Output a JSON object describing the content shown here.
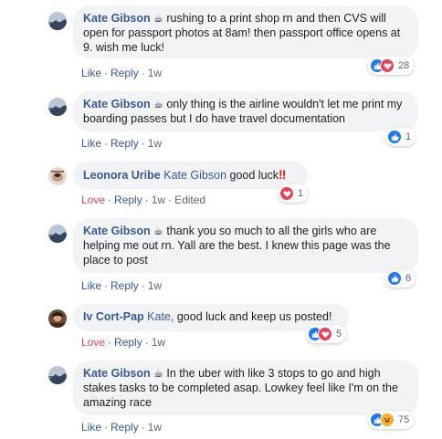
{
  "comments": [
    {
      "author": "Kate Gibson",
      "badge": "☕",
      "text": "rushing to a print shop rn and then CVS will open for passport photos at 8am! then passport office opens at 9. wish me luck!",
      "actions": [
        "Like",
        "Reply"
      ],
      "time": "1w",
      "reactions": [
        "like",
        "love"
      ],
      "count": "28"
    },
    {
      "author": "Kate Gibson",
      "badge": "☕",
      "text": "only thing is the airline wouldn't let me print my boarding passes but I do have travel documentation",
      "actions": [
        "Like",
        "Reply"
      ],
      "time": "1w",
      "reactions": [
        "like"
      ],
      "count": "1"
    },
    {
      "author": "Leonora Uribe",
      "mention": "Kate Gibson",
      "text": "good luck",
      "emphasis": "‼",
      "actions": [
        "Love",
        "Reply"
      ],
      "time": "1w",
      "edited": "Edited",
      "reactions": [
        "love"
      ],
      "count": "1"
    },
    {
      "author": "Kate Gibson",
      "badge": "☕",
      "text": "thank you so much to all the girls who are helping me out rn. Yall are the best. I knew this page was the place to post",
      "actions": [
        "Like",
        "Reply"
      ],
      "time": "1w",
      "reactions": [
        "like"
      ],
      "count": "6"
    },
    {
      "author": "Iv Cort-Pap",
      "mention": "Kate,",
      "text": "good luck and keep us posted!",
      "actions": [
        "Love",
        "Reply"
      ],
      "time": "1w",
      "reactions": [
        "like",
        "love"
      ],
      "count": "5"
    },
    {
      "author": "Kate Gibson",
      "badge": "☕",
      "text": "In the uber with like 3 stops to go and high stakes tasks to be completed asap. Lowkey feel like I'm on the amazing race",
      "actions": [
        "Like",
        "Reply"
      ],
      "time": "1w",
      "reactions": [
        "like",
        "haha"
      ],
      "count": "75"
    }
  ],
  "colors": {
    "link": "#385898",
    "love": "#f33e58",
    "like": "#2078f4",
    "haha": "#f7b125",
    "bubble": "#f2f3f5",
    "meta": "#606770"
  },
  "icons": {
    "like": "thumbs-up-icon",
    "love": "heart-icon",
    "haha": "laughing-face-icon"
  }
}
